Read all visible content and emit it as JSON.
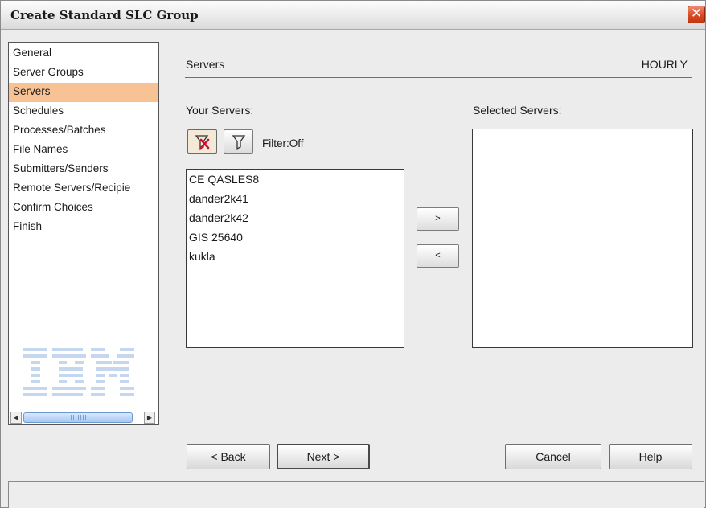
{
  "window": {
    "title": "Create Standard SLC Group",
    "close_glyph": "✕"
  },
  "nav": {
    "items": [
      {
        "label": "General",
        "selected": false
      },
      {
        "label": "Server Groups",
        "selected": false
      },
      {
        "label": "Servers",
        "selected": true
      },
      {
        "label": "Schedules",
        "selected": false
      },
      {
        "label": "Processes/Batches",
        "selected": false
      },
      {
        "label": "File Names",
        "selected": false
      },
      {
        "label": "Submitters/Senders",
        "selected": false
      },
      {
        "label": "Remote Servers/Recipie",
        "selected": false
      },
      {
        "label": "Confirm Choices",
        "selected": false
      },
      {
        "label": "Finish",
        "selected": false
      }
    ],
    "logo": "IBM",
    "scroll_left_glyph": "◀",
    "scroll_right_glyph": "▶"
  },
  "section": {
    "title": "Servers",
    "schedule": "HOURLY"
  },
  "servers": {
    "your_label": "Your Servers:",
    "selected_label": "Selected Servers:",
    "filter_status": "Filter:Off",
    "list": [
      "CE QASLES8",
      "dander2k41",
      "dander2k42",
      "GIS 25640",
      "kukla"
    ],
    "selected_list": []
  },
  "buttons": {
    "add": ">",
    "remove": "<",
    "back": "< Back",
    "next": "Next >",
    "cancel": "Cancel",
    "help": "Help"
  },
  "icons": {
    "filter_clear": "filter-clear-icon",
    "filter": "filter-icon"
  },
  "colors": {
    "nav_selected": "#f7c394",
    "close_button": "#d94a24",
    "logo_blue": "#c5d7ee"
  }
}
